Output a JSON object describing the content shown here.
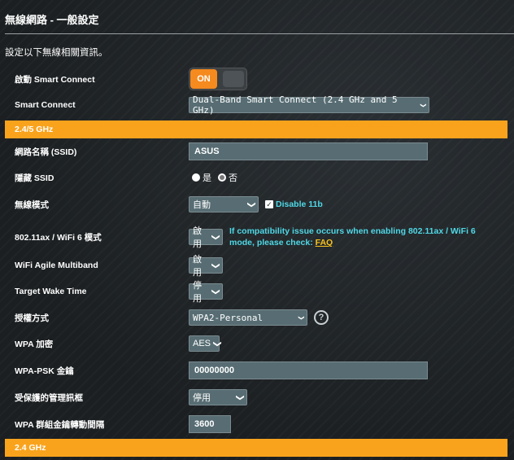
{
  "header": {
    "title": "無線網路 - 一般設定",
    "description": "設定以下無線相關資訊。"
  },
  "smart_connect_enable": {
    "label": "啟動 Smart Connect",
    "toggle_text": "ON",
    "state": "on"
  },
  "smart_connect": {
    "label": "Smart Connect",
    "value": "Dual-Band Smart Connect (2.4 GHz and 5 GHz)"
  },
  "section_245": {
    "title": "2.4/5 GHz"
  },
  "ssid": {
    "label": "網路名稱 (SSID)",
    "value": "ASUS"
  },
  "hide_ssid": {
    "label": "隱藏 SSID",
    "option_yes": "是",
    "option_no": "否",
    "selected": "是"
  },
  "wireless_mode": {
    "label": "無線模式",
    "value": "自動",
    "disable11b_label": "Disable 11b",
    "disable11b_checked": true
  },
  "wifi6_mode": {
    "label": "802.11ax / WiFi 6 模式",
    "value": "啟用",
    "note": "If compatibility issue occurs when enabling 802.11ax / WiFi 6 mode, please check:",
    "faq_link": "FAQ"
  },
  "agile_multiband": {
    "label": "WiFi Agile Multiband",
    "value": "啟用"
  },
  "target_wake_time": {
    "label": "Target Wake Time",
    "value": "停用"
  },
  "auth_method": {
    "label": "授權方式",
    "value": "WPA2-Personal",
    "help_icon": "question-icon"
  },
  "wpa_encryption": {
    "label": "WPA 加密",
    "value": "AES"
  },
  "wpa_psk": {
    "label": "WPA-PSK 金鑰",
    "value": "00000000"
  },
  "protected_mgmt": {
    "label": "受保護的管理訊框",
    "value": "停用"
  },
  "group_key_interval": {
    "label": "WPA 群組金鑰轉動間隔",
    "value": "3600"
  },
  "section_24": {
    "title": "2.4 GHz"
  },
  "colors": {
    "accent": "#f9a31d",
    "toggle_on": "#f58a1f",
    "link_cyan": "#4fd8e6",
    "faq": "#f9c41d",
    "field_bg": "#576d73"
  }
}
